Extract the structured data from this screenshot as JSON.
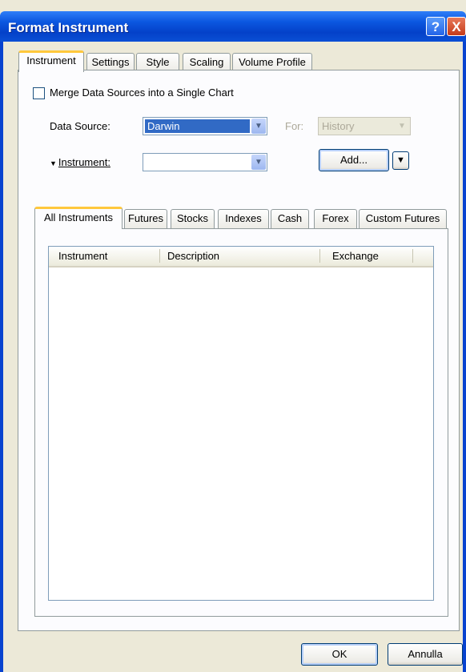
{
  "window": {
    "title": "Format Instrument",
    "help_glyph": "?",
    "close_glyph": "X"
  },
  "outer_tabs": [
    {
      "label": "Instrument",
      "active": true
    },
    {
      "label": "Settings",
      "active": false
    },
    {
      "label": "Style",
      "active": false
    },
    {
      "label": "Scaling",
      "active": false
    },
    {
      "label": "Volume Profile",
      "active": false
    }
  ],
  "merge_checkbox": {
    "label": "Merge Data Sources into a Single Chart",
    "checked": false
  },
  "data_source": {
    "label": "Data Source:",
    "value": "Darwin"
  },
  "for_field": {
    "label": "For:",
    "value": "History",
    "disabled": true
  },
  "instrument": {
    "label": "Instrument:",
    "value": ""
  },
  "add_button": {
    "label": "Add..."
  },
  "icons": {
    "dropdown": "chevron-down-icon",
    "expand": "triangle-down-icon"
  },
  "inner_tabs": [
    {
      "label": "All Instruments",
      "active": true
    },
    {
      "label": "Futures",
      "active": false
    },
    {
      "label": "Stocks",
      "active": false
    },
    {
      "label": "Indexes",
      "active": false
    },
    {
      "label": "Cash",
      "active": false
    },
    {
      "label": "Forex",
      "active": false
    },
    {
      "label": "Custom Futures",
      "active": false
    }
  ],
  "table": {
    "columns": [
      "Instrument",
      "Description",
      "Exchange"
    ],
    "rows": []
  },
  "footer": {
    "ok_label": "OK",
    "cancel_label": "Annulla"
  },
  "colors": {
    "title_bar": "#0a4fd5",
    "dialog_bg": "#ece9d8",
    "tab_highlight": "#ffc83c",
    "selection": "#316ac5"
  }
}
